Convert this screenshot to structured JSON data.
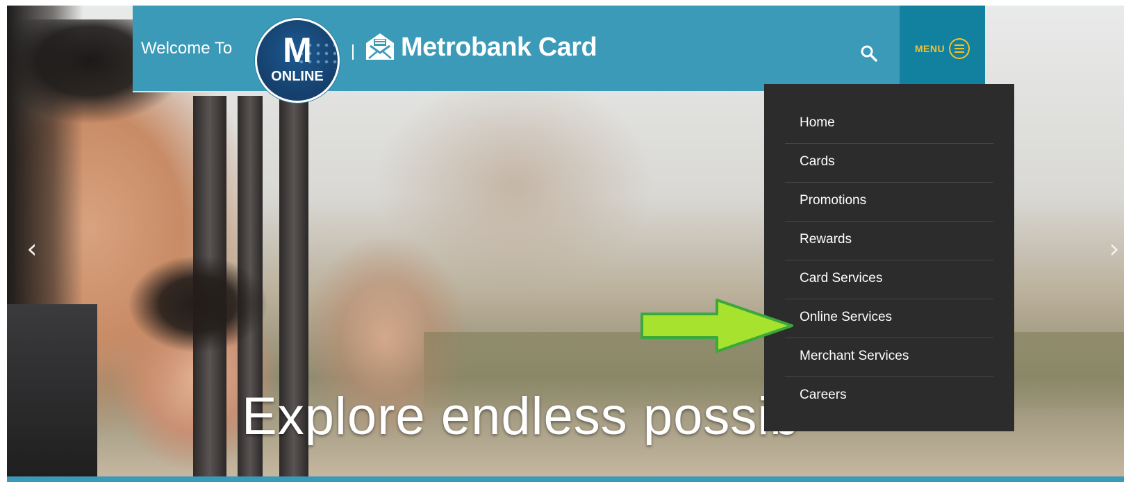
{
  "header": {
    "welcome_text": "Welcome To",
    "logo_letter": "M",
    "logo_subtext": "ONLINE",
    "brand_name": "Metrobank Card"
  },
  "menu": {
    "label": "MENU",
    "items": [
      {
        "label": "Home"
      },
      {
        "label": "Cards"
      },
      {
        "label": "Promotions"
      },
      {
        "label": "Rewards"
      },
      {
        "label": "Card Services"
      },
      {
        "label": "Online Services"
      },
      {
        "label": "Merchant Services"
      },
      {
        "label": "Careers"
      }
    ],
    "highlighted_item": "Online Services"
  },
  "hero": {
    "headline": "Explore endless possib",
    "prev_icon": "chevron-left-icon",
    "next_icon": "chevron-right-icon"
  },
  "icons": {
    "search": "search-icon",
    "menu": "hamburger-icon",
    "brand": "envelope-logo-icon",
    "annotation": "green-arrow-icon"
  },
  "colors": {
    "header_bg": "#3b9ab7",
    "menu_button_bg": "#12809f",
    "menu_accent": "#f3c32b",
    "dropdown_bg": "#2c2c2c",
    "annotation_arrow": "#a6e22e"
  }
}
